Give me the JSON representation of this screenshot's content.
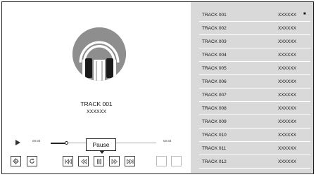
{
  "player": {
    "now_playing_title": "TRACK 001",
    "now_playing_artist": "XXXXXX",
    "elapsed": "00:33",
    "duration": "00:33",
    "progress": 0.15,
    "tooltip": "Pause"
  },
  "controls": {
    "settings_icon": "gear-icon",
    "shuffle_icon": "refresh-icon",
    "first_icon": "skip-to-start-icon",
    "prev_icon": "previous-icon",
    "pause_icon": "pause-icon",
    "next_icon": "next-icon",
    "last_icon": "skip-to-end-icon"
  },
  "playlist": {
    "items": [
      {
        "title": "TRACK 001",
        "artist": "XXXXXX",
        "marker": "■"
      },
      {
        "title": "TRACK 002",
        "artist": "XXXXXX",
        "marker": ""
      },
      {
        "title": "TRACK 003",
        "artist": "XXXXXX",
        "marker": ""
      },
      {
        "title": "TRACK 004",
        "artist": "XXXXXX",
        "marker": ""
      },
      {
        "title": "TRACK 005",
        "artist": "XXXXXX",
        "marker": ""
      },
      {
        "title": "TRACK 006",
        "artist": "XXXXXX",
        "marker": ""
      },
      {
        "title": "TRACK 007",
        "artist": "XXXXXX",
        "marker": ""
      },
      {
        "title": "TRACK 008",
        "artist": "XXXXXX",
        "marker": ""
      },
      {
        "title": "TRACK 009",
        "artist": "XXXXXX",
        "marker": ""
      },
      {
        "title": "TRACK 010",
        "artist": "XXXXXX",
        "marker": ""
      },
      {
        "title": "TRACK 011",
        "artist": "XXXXXX",
        "marker": ""
      },
      {
        "title": "TRACK 012",
        "artist": "XXXXXX",
        "marker": ""
      }
    ]
  }
}
